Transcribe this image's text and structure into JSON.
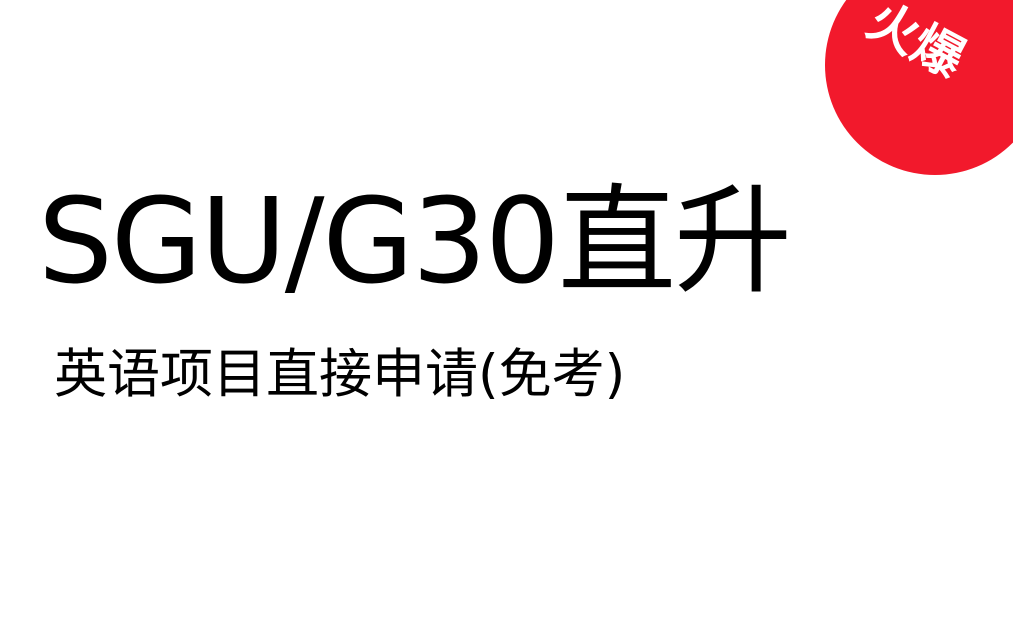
{
  "badge": {
    "text": "火爆",
    "color": "#f2192c"
  },
  "headline": "SGU/G30直升",
  "subline": "英语项目直接申请(免考)"
}
